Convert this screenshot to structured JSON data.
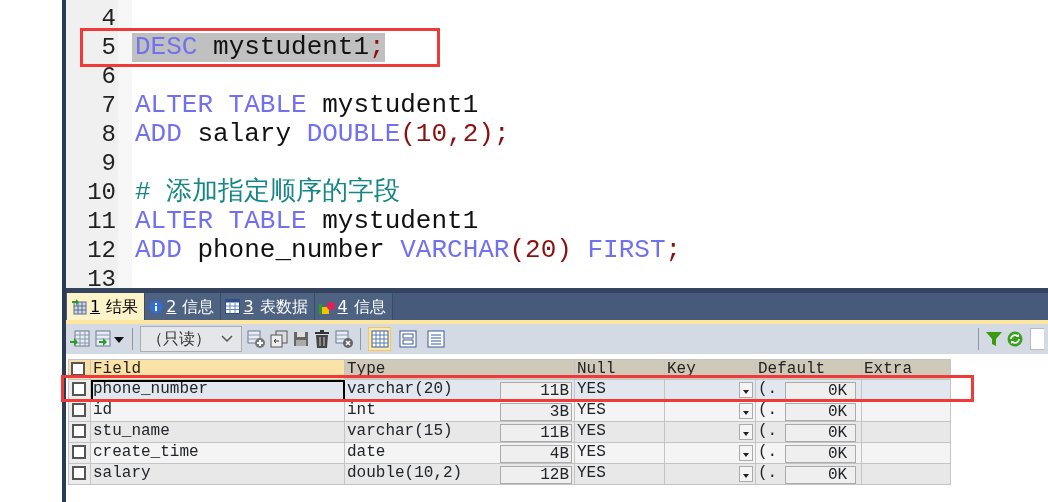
{
  "editor": {
    "lines": [
      {
        "number": "4",
        "selected": false,
        "boxed": false
      },
      {
        "number": "5",
        "tokens": [
          {
            "kind": "keyword",
            "text": "DESC"
          },
          {
            "kind": "name",
            "text": " mystudent1"
          },
          {
            "kind": "punct",
            "text": ";"
          }
        ],
        "selected": true,
        "boxed": true
      },
      {
        "number": "6",
        "selected": false,
        "boxed": false
      },
      {
        "number": "7",
        "tokens": [
          {
            "kind": "keyword",
            "text": "ALTER TABLE"
          },
          {
            "kind": "name",
            "text": " mystudent1"
          }
        ],
        "selected": false,
        "boxed": false
      },
      {
        "number": "8",
        "tokens": [
          {
            "kind": "keyword",
            "text": "ADD"
          },
          {
            "kind": "name",
            "text": " salary "
          },
          {
            "kind": "keyword",
            "text": "DOUBLE"
          },
          {
            "kind": "punct",
            "text": "(10,2);"
          }
        ],
        "selected": false,
        "boxed": false
      },
      {
        "number": "9",
        "selected": false,
        "boxed": false
      },
      {
        "number": "10",
        "tokens": [
          {
            "kind": "comment",
            "text": "# 添加指定顺序的字段"
          }
        ],
        "selected": false,
        "boxed": false
      },
      {
        "number": "11",
        "tokens": [
          {
            "kind": "keyword",
            "text": "ALTER TABLE"
          },
          {
            "kind": "name",
            "text": " mystudent1"
          }
        ],
        "selected": false,
        "boxed": false
      },
      {
        "number": "12",
        "tokens": [
          {
            "kind": "keyword",
            "text": "ADD"
          },
          {
            "kind": "name",
            "text": " phone_number "
          },
          {
            "kind": "keyword",
            "text": "VARCHAR"
          },
          {
            "kind": "punct",
            "text": "(20) "
          },
          {
            "kind": "keyword",
            "text": "FIRST"
          },
          {
            "kind": "punct",
            "text": ";"
          }
        ],
        "selected": false,
        "boxed": false
      },
      {
        "number": "13",
        "selected": false,
        "boxed": false
      }
    ]
  },
  "tabs": [
    {
      "kind": "result",
      "number": "1",
      "label": "结果",
      "selected": true
    },
    {
      "kind": "info",
      "number": "2",
      "label": "信息",
      "selected": false
    },
    {
      "kind": "table",
      "number": "3",
      "label": "表数据",
      "selected": false
    },
    {
      "kind": "profile",
      "number": "4",
      "label": "信息",
      "selected": false
    }
  ],
  "toolbar": {
    "mode_dropdown": {
      "value": "（只读）"
    },
    "view_buttons": [
      {
        "kind": "grid",
        "selected": true
      },
      {
        "kind": "form",
        "selected": false
      },
      {
        "kind": "text",
        "selected": false
      }
    ]
  },
  "grid": {
    "all_checked": false,
    "columns": [
      "Field",
      "Type",
      "Null",
      "Key",
      "Default",
      "Extra"
    ],
    "rows": [
      {
        "checked": false,
        "selected": true,
        "boxed": true,
        "field": "phone_number",
        "type": "varchar(20)",
        "size": "11B",
        "null": "YES",
        "default": "(.",
        "default_size": "0K"
      },
      {
        "checked": false,
        "selected": false,
        "boxed": false,
        "field": "id",
        "type": "int",
        "size": "3B",
        "null": "YES",
        "default": "(.",
        "default_size": "0K"
      },
      {
        "checked": false,
        "selected": false,
        "boxed": false,
        "field": "stu_name",
        "type": "varchar(15)",
        "size": "11B",
        "null": "YES",
        "default": "(.",
        "default_size": "0K"
      },
      {
        "checked": false,
        "selected": false,
        "boxed": false,
        "field": "create_time",
        "type": "date",
        "size": "4B",
        "null": "YES",
        "default": "(.",
        "default_size": "0K"
      },
      {
        "checked": false,
        "selected": false,
        "boxed": false,
        "field": "salary",
        "type": "double(10,2)",
        "size": "12B",
        "null": "YES",
        "default": "(.",
        "default_size": "0K"
      }
    ]
  }
}
